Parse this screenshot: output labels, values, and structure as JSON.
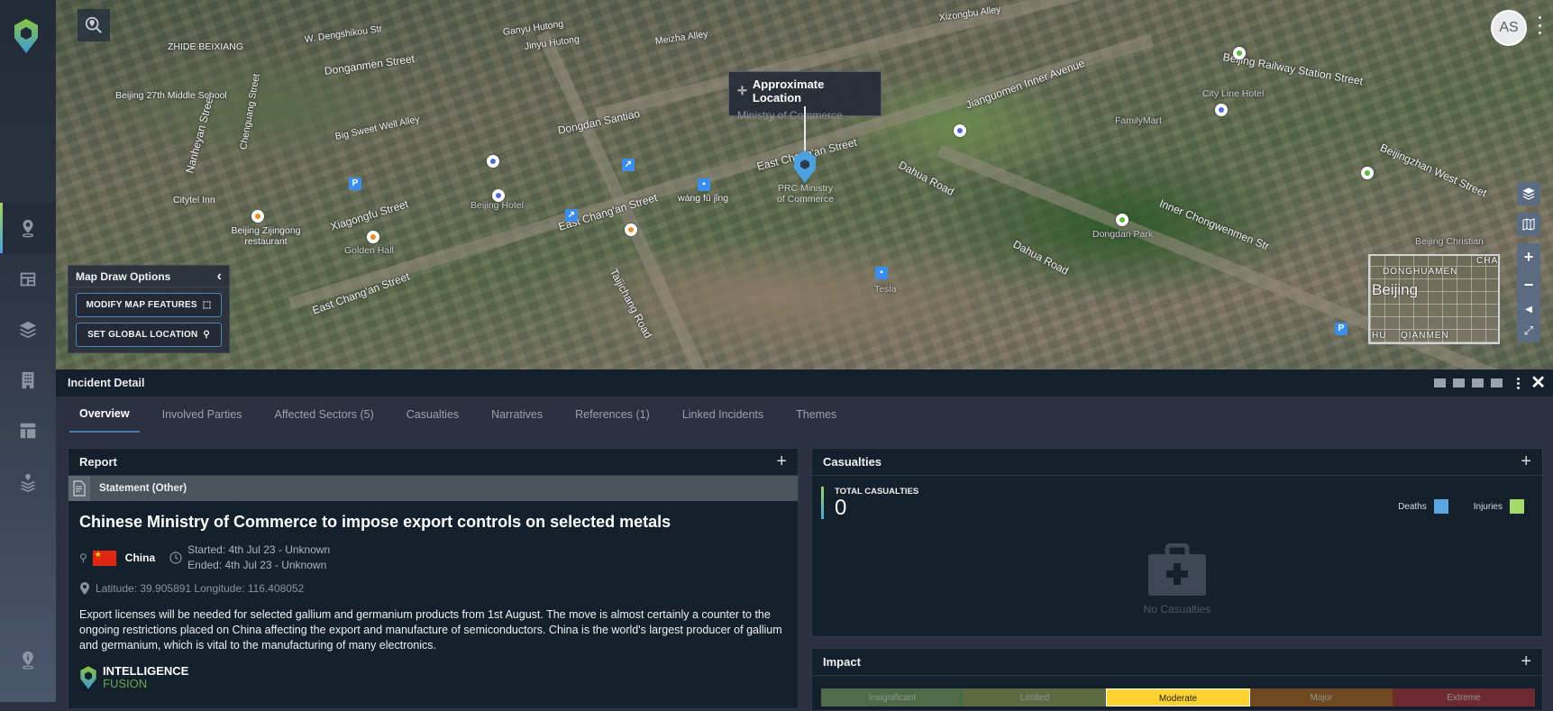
{
  "app": {
    "avatar_initials": "AS"
  },
  "sidebar": {
    "items": [
      {
        "name": "location-pin",
        "active": true
      },
      {
        "name": "dashboard"
      },
      {
        "name": "layers"
      },
      {
        "name": "building"
      },
      {
        "name": "table-layout"
      },
      {
        "name": "location-layers"
      },
      {
        "name": "location-info"
      }
    ]
  },
  "map": {
    "tooltip": {
      "title": "Approximate Location",
      "subtitle": "Ministry of Commerce"
    },
    "marker_label": "PRC Ministry\nof Commerce",
    "labels": [
      {
        "text": "East Chang'an Street"
      },
      {
        "text": "East Chang'an Street"
      },
      {
        "text": "East Chang'an Street"
      },
      {
        "text": "Xiagongfu Street"
      },
      {
        "text": "Taijichang Road"
      },
      {
        "text": "Dahua Road"
      },
      {
        "text": "Dahua Road"
      },
      {
        "text": "Inner Chongwenmen Str"
      },
      {
        "text": "Dongdan Park"
      },
      {
        "text": "Jianguomen Inner Avenue"
      },
      {
        "text": "Beijing Railway Station Street"
      },
      {
        "text": "Beijingzhan West Street"
      },
      {
        "text": "Dongdan Santiao"
      },
      {
        "text": "Donganmen Street"
      },
      {
        "text": "Big Sweet Well Alley"
      },
      {
        "text": "W. Dengshikou Str"
      },
      {
        "text": "Jinyu Hutong"
      },
      {
        "text": "Ganyu Hutong"
      },
      {
        "text": "Meizha Alley"
      },
      {
        "text": "Nanheyan Street"
      },
      {
        "text": "Chenguang Street"
      },
      {
        "text": "Beijing 27th Middle School"
      },
      {
        "text": "Citytel Inn"
      },
      {
        "text": "Beijing Zijingong restaurant"
      },
      {
        "text": "Golden Hall"
      },
      {
        "text": "Beijing Hotel"
      },
      {
        "text": "wáng fǔ jǐng"
      },
      {
        "text": "Tesla"
      },
      {
        "text": "FamilyMart"
      },
      {
        "text": "City Line Hotel"
      },
      {
        "text": "Beijing Christian"
      },
      {
        "text": "ZHIDE BEIXIANG"
      },
      {
        "text": "Xizongbu Alley"
      }
    ],
    "minimap": {
      "city": "Beijing",
      "labels": [
        "DONGHUAMEN",
        "QIANMEN",
        "HU",
        "CHA"
      ]
    },
    "draw_options": {
      "title": "Map Draw Options",
      "modify_label": "MODIFY MAP FEATURES",
      "global_location_label": "SET GLOBAL LOCATION"
    },
    "controls": {
      "zoom_in": "+",
      "zoom_out": "−"
    }
  },
  "incident": {
    "header_title": "Incident Detail",
    "tabs": [
      {
        "label": "Overview",
        "active": true
      },
      {
        "label": "Involved Parties"
      },
      {
        "label": "Affected Sectors (5)"
      },
      {
        "label": "Casualties"
      },
      {
        "label": "Narratives"
      },
      {
        "label": "References (1)"
      },
      {
        "label": "Linked Incidents"
      },
      {
        "label": "Themes"
      }
    ],
    "report": {
      "panel_title": "Report",
      "type": "Statement (Other)",
      "title": "Chinese Ministry of Commerce to impose export controls on selected metals",
      "country": "China",
      "started": "Started: 4th Jul 23 - Unknown",
      "ended": "Ended: 4th Jul 23 - Unknown",
      "coordinates": "Latitude: 39.905891 Longitude: 116.408052",
      "description": "Export licenses will be needed for selected gallium and germanium products from 1st August. The move is almost certainly a counter to the ongoing restrictions placed on China affecting the export and manufacture of semiconductors. China is the world's largest producer of gallium and germanium, which is vital to the manufacturing of many electronics.",
      "brand_line1": "INTELLIGENCE",
      "brand_line2": "FUSION"
    },
    "casualties": {
      "panel_title": "Casualties",
      "total_label": "TOTAL CASUALTIES",
      "total_value": "0",
      "legend": [
        {
          "label": "Deaths",
          "color": "#5aa7e0"
        },
        {
          "label": "Injuries",
          "color": "#a6d86a"
        }
      ],
      "empty_text": "No Casualties"
    },
    "impact": {
      "panel_title": "Impact",
      "levels": [
        {
          "label": "Insignificant",
          "color": "#4e6b47"
        },
        {
          "label": "Limited",
          "color": "#5e6a42"
        },
        {
          "label": "Moderate",
          "color": "#ffd230",
          "selected": true
        },
        {
          "label": "Major",
          "color": "#6f4a21"
        },
        {
          "label": "Extreme",
          "color": "#6d2b31"
        }
      ]
    }
  }
}
